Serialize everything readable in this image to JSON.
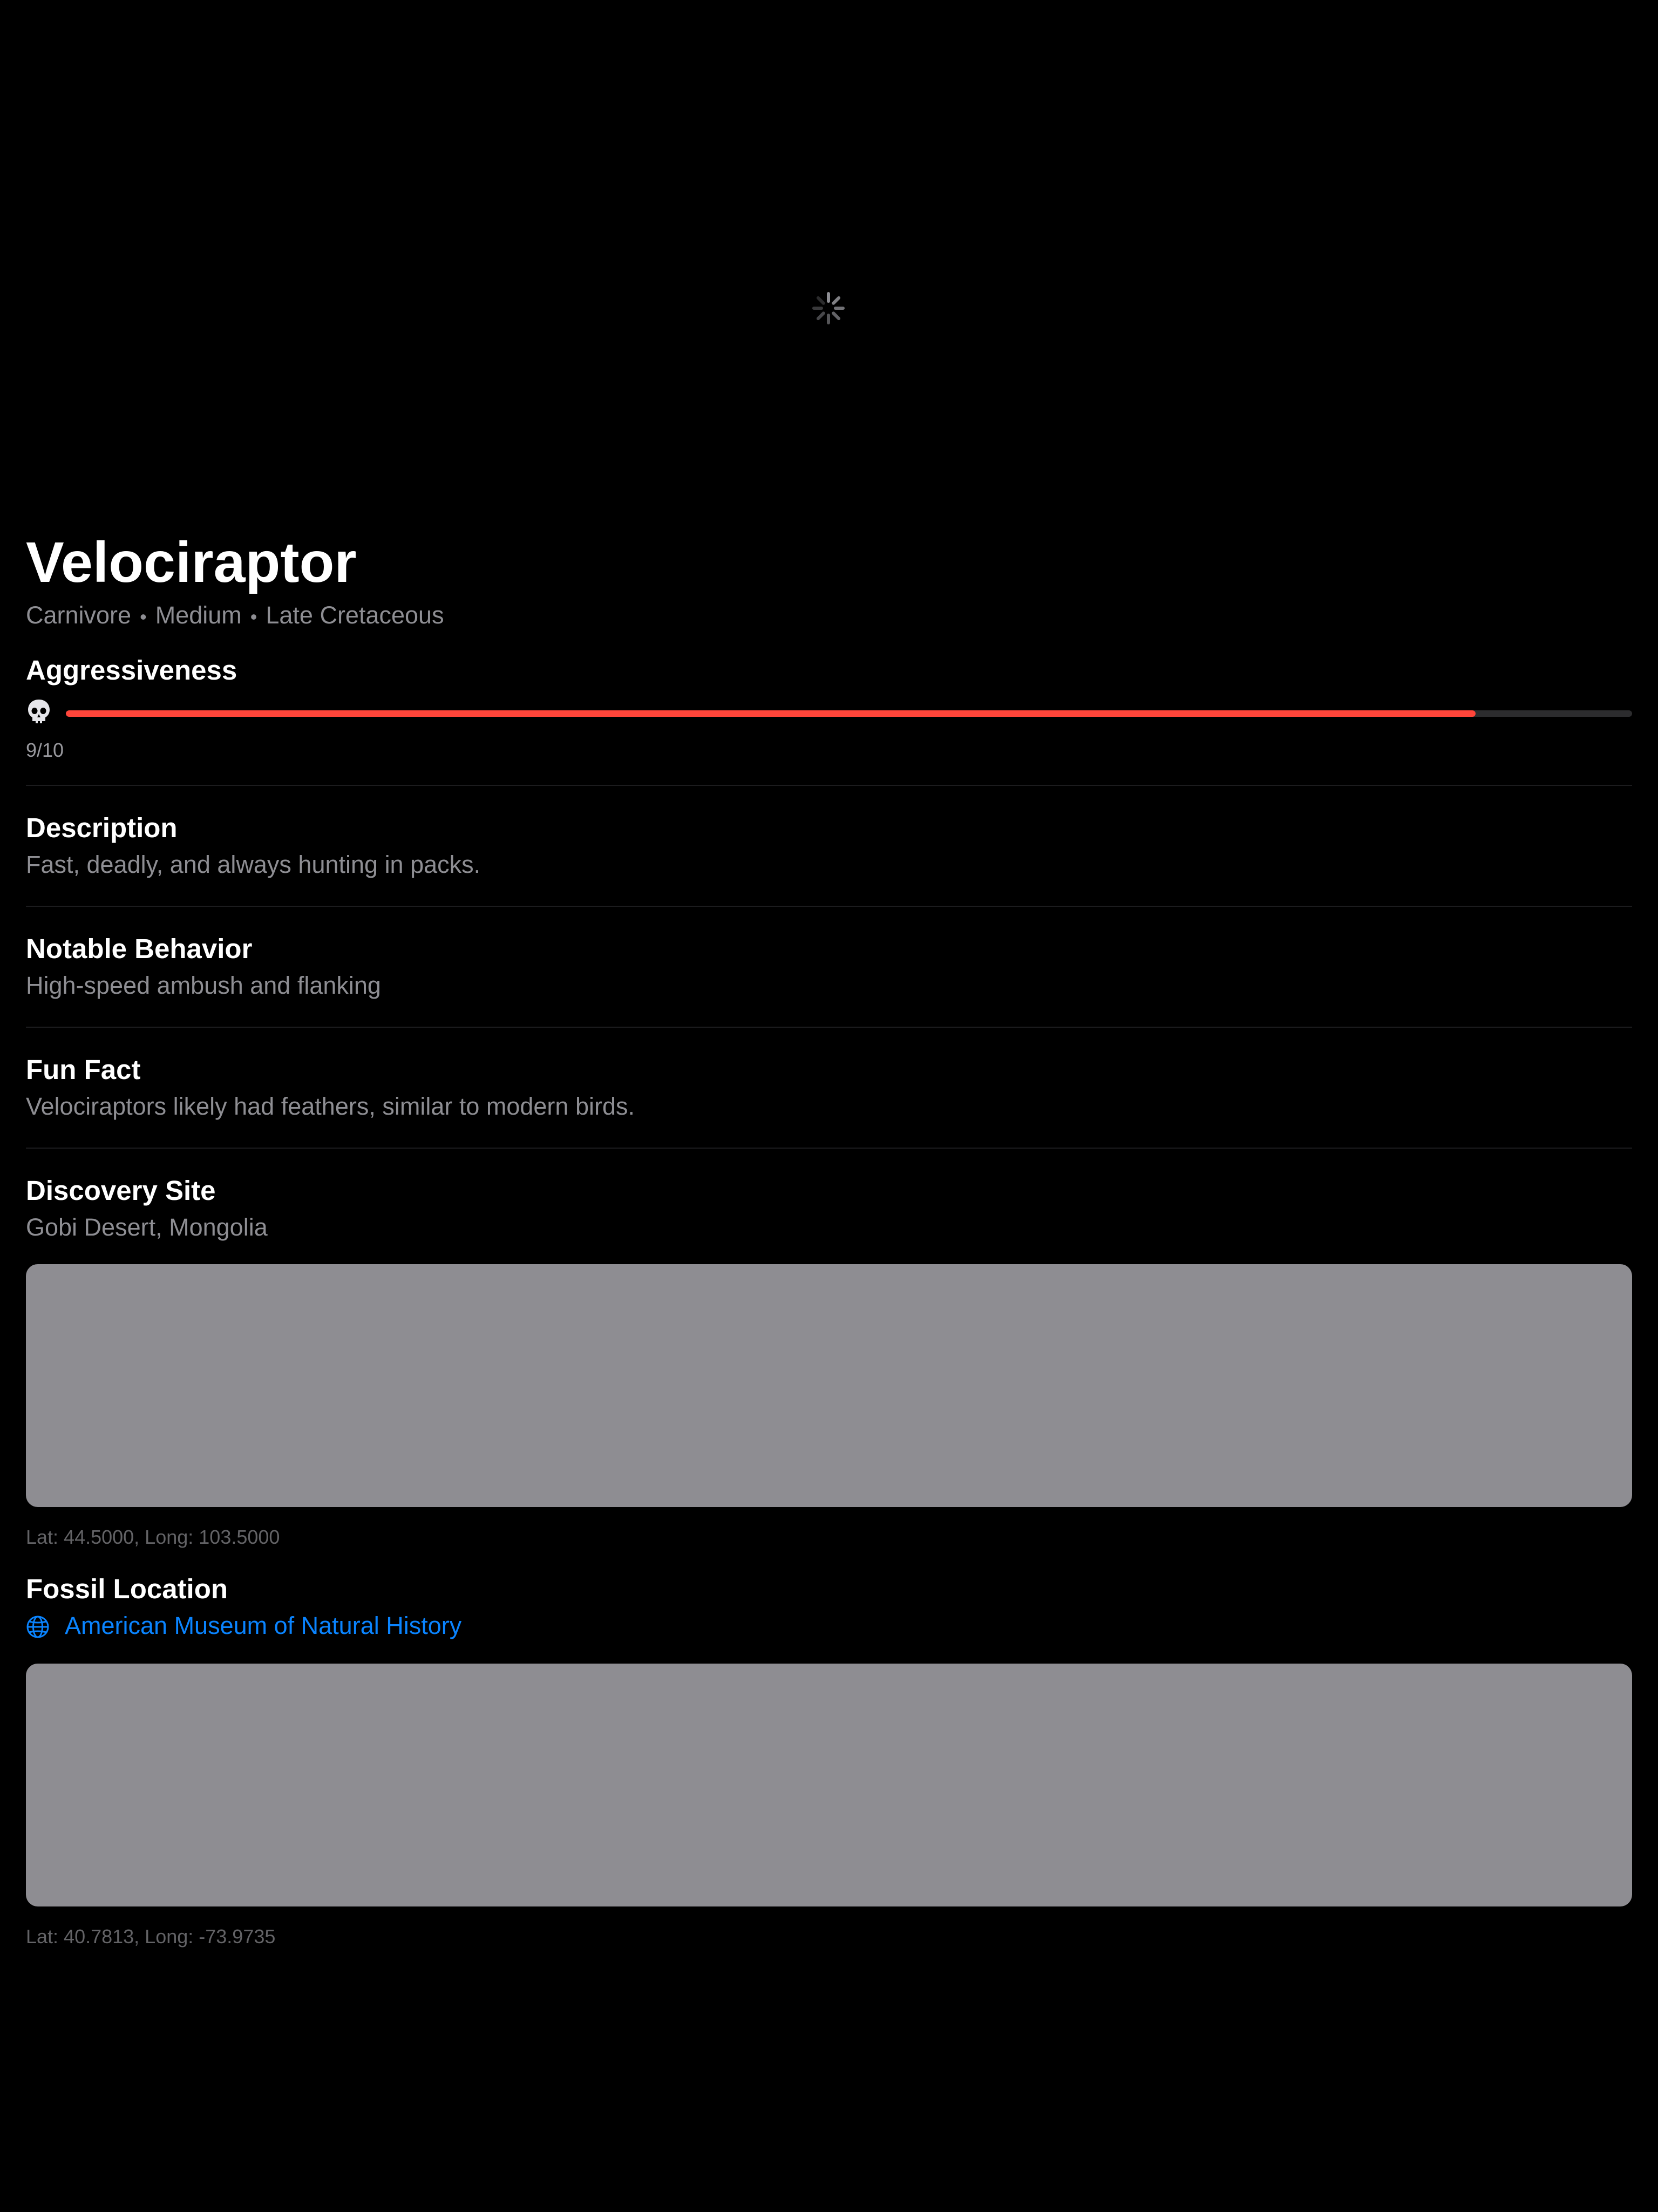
{
  "hero": {
    "loading_icon": "activity-spinner-icon"
  },
  "dinosaur": {
    "name": "Velociraptor",
    "diet": "Carnivore",
    "size": "Medium",
    "period": "Late Cretaceous",
    "separator": "•"
  },
  "aggressiveness": {
    "title": "Aggressiveness",
    "icon": "skull-icon",
    "value": 9,
    "max": 10,
    "label": "9/10",
    "bar_color": "#ff453a",
    "track_color": "#2c2c2e"
  },
  "sections": {
    "description": {
      "title": "Description",
      "text": "Fast, deadly, and always hunting in packs."
    },
    "behavior": {
      "title": "Notable Behavior",
      "text": "High-speed ambush and flanking"
    },
    "fun_fact": {
      "title": "Fun Fact",
      "text": "Velociraptors likely had feathers, similar to modern birds."
    }
  },
  "discovery": {
    "title": "Discovery Site",
    "place": "Gobi Desert, Mongolia",
    "coords": "Lat: 44.5000, Long: 103.5000"
  },
  "fossil": {
    "title": "Fossil Location",
    "icon": "globe-icon",
    "museum": "American Museum of Natural History",
    "coords": "Lat: 40.7813, Long: -73.9735"
  },
  "colors": {
    "background": "#000000",
    "primary_text": "#ffffff",
    "secondary_text": "#8e8e93",
    "link": "#0a84ff",
    "map_placeholder": "#8e8d92"
  }
}
